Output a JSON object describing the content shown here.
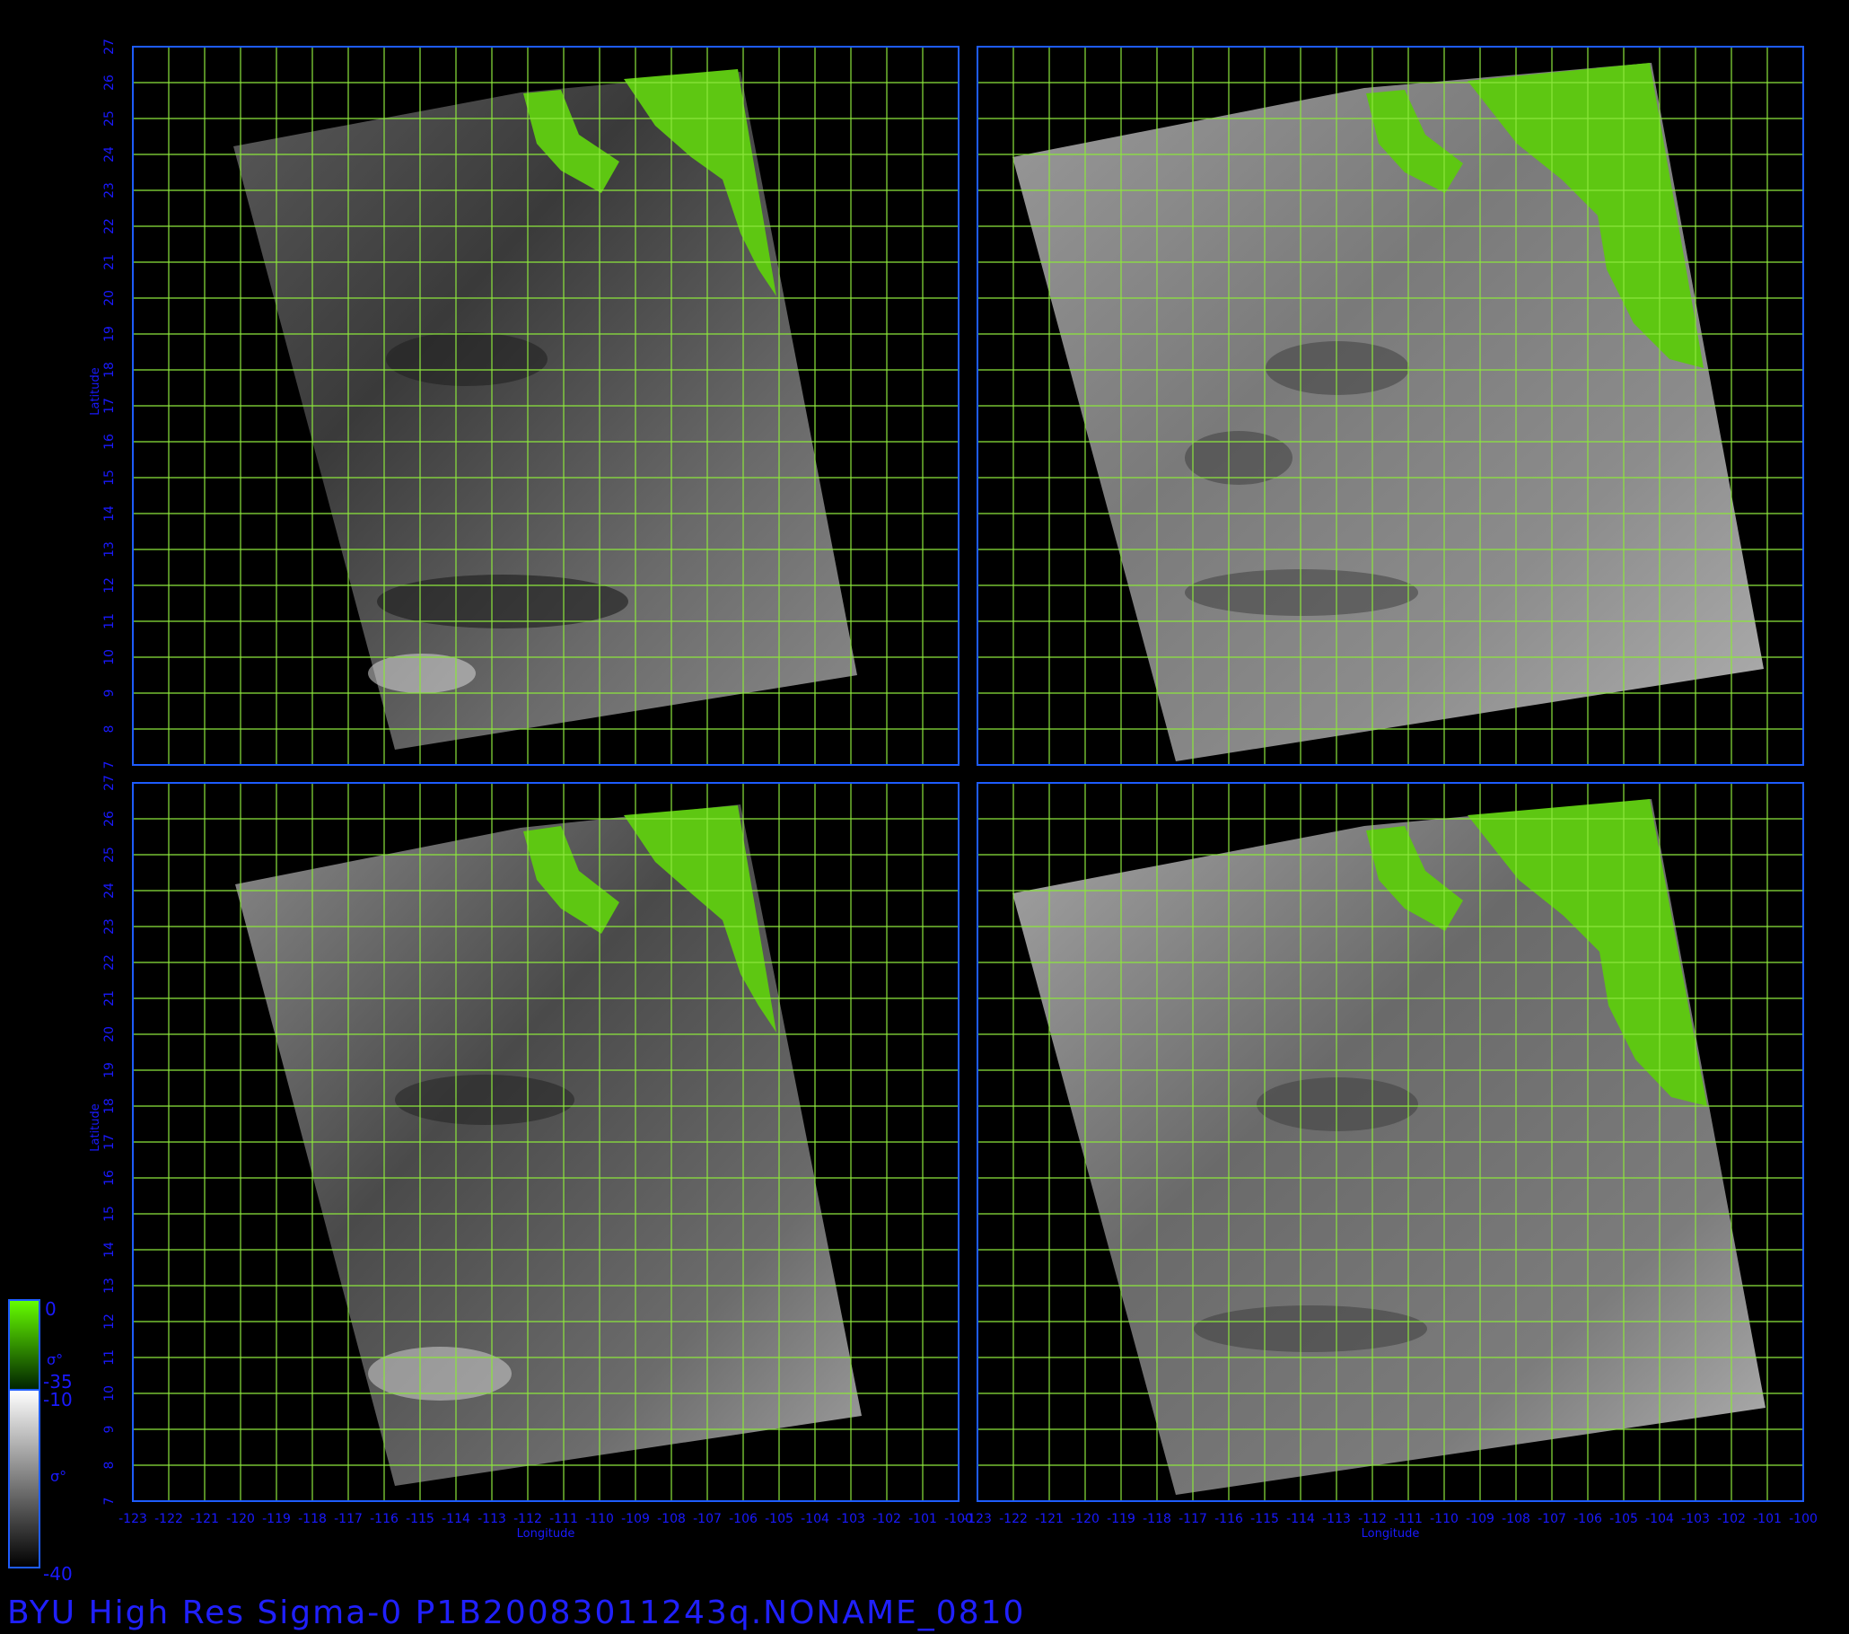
{
  "footer_title": "BYU  High  Res  Sigma-0  P1B20083011243q.NONAME_0810",
  "axes": {
    "xlabel": "Longitude",
    "ylabel": "Latitude",
    "lon_range": [
      -123,
      -100
    ],
    "lat_range": [
      7,
      27
    ],
    "lon_ticks": [
      "-123",
      "-122",
      "-121",
      "-120",
      "-119",
      "-118",
      "-117",
      "-116",
      "-115",
      "-114",
      "-113",
      "-112",
      "-111",
      "-110",
      "-109",
      "-108",
      "-107",
      "-106",
      "-105",
      "-104",
      "-103",
      "-102",
      "-101",
      "-100"
    ],
    "lat_ticks": [
      "7",
      "8",
      "9",
      "10",
      "11",
      "12",
      "13",
      "14",
      "15",
      "16",
      "17",
      "18",
      "19",
      "20",
      "21",
      "22",
      "23",
      "24",
      "25",
      "26",
      "27"
    ],
    "grid": true
  },
  "panels": [
    {
      "id": "upper-left",
      "lon": "left-half",
      "lat": "upper-half"
    },
    {
      "id": "upper-right",
      "lon": "right-half",
      "lat": "upper-half"
    },
    {
      "id": "lower-left",
      "lon": "left-half",
      "lat": "lower-half"
    },
    {
      "id": "lower-right",
      "lon": "right-half",
      "lat": "lower-half"
    }
  ],
  "colorbars": {
    "land": {
      "top_label": "0",
      "symbol": "σ°",
      "bottom_label": "-35",
      "gradient": [
        "#66ff00",
        "#003300"
      ]
    },
    "ocean": {
      "top_label": "-10",
      "symbol": "σ°",
      "bottom_label": "-40",
      "gradient": [
        "#ffffff",
        "#000000"
      ]
    }
  },
  "colors": {
    "frame": "#1e5cff",
    "grid": "#8ce63c",
    "label": "#1a1aff",
    "land": "#5ec712",
    "ocean_light": "#a8a8a8",
    "ocean_dark": "#303030"
  }
}
